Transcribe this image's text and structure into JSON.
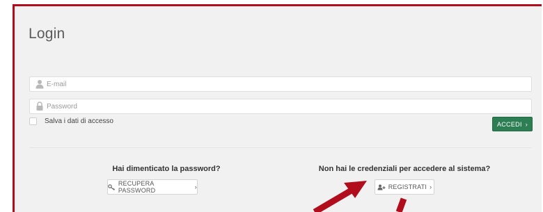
{
  "login": {
    "title": "Login",
    "email_placeholder": "E-mail",
    "password_placeholder": "Password",
    "remember_label": "Salva i dati di accesso",
    "submit_label": "ACCEDI",
    "submit_chevron": "›"
  },
  "forgot": {
    "question": "Hai dimenticato la password?",
    "button_label": "RECUPERA PASSWORD",
    "button_chevron": "›"
  },
  "register": {
    "question": "Non hai le credenziali per accedere al sistema?",
    "button_label": "REGISTRATI",
    "button_chevron": "›"
  },
  "colors": {
    "frame": "#b10d1d",
    "primary": "#2e7e54",
    "annotation_arrow": "#b10d1d"
  },
  "icons": [
    "user-icon",
    "lock-icon",
    "key-icon",
    "add-user-icon"
  ]
}
